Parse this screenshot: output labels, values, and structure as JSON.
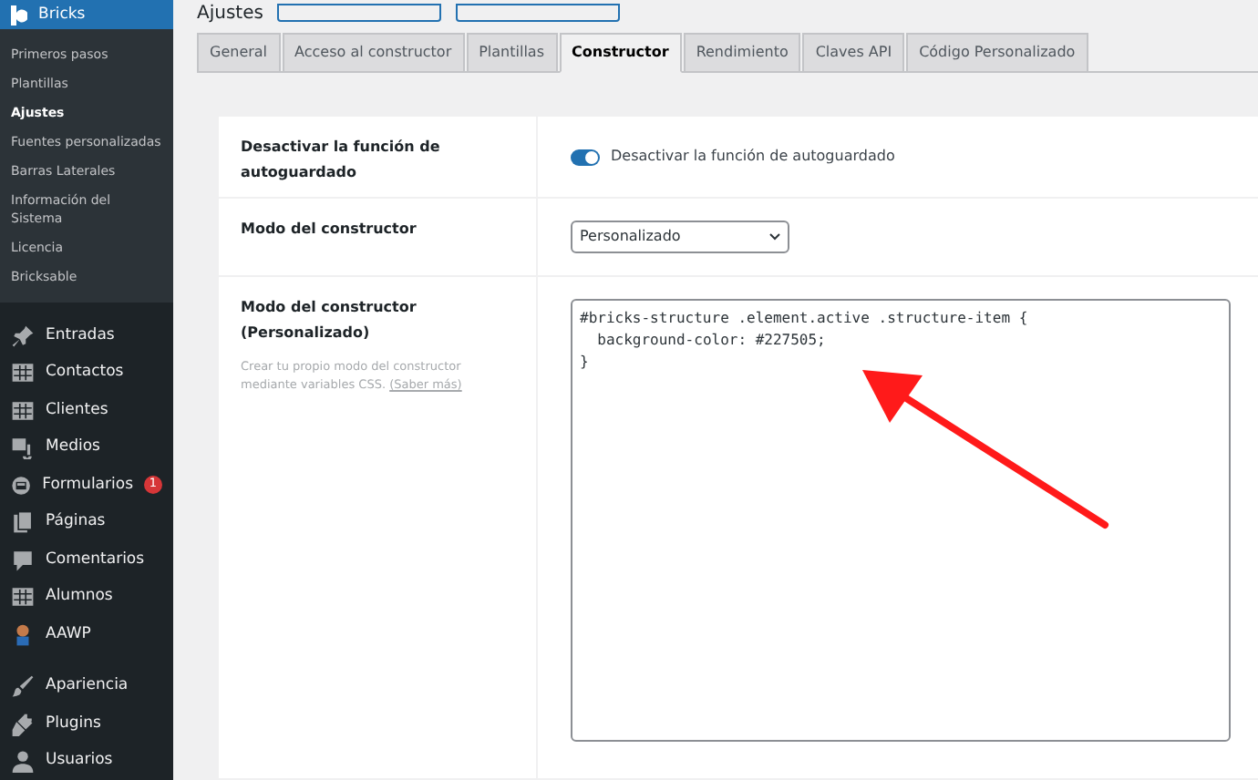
{
  "page_title": "Ajustes",
  "sidebar": {
    "brand": "Bricks",
    "submenu": [
      {
        "label": "Primeros pasos",
        "selected": false
      },
      {
        "label": "Plantillas",
        "selected": false
      },
      {
        "label": "Ajustes",
        "selected": true
      },
      {
        "label": "Fuentes personalizadas",
        "selected": false
      },
      {
        "label": "Barras Laterales",
        "selected": false
      },
      {
        "label": "Información del Sistema",
        "selected": false
      },
      {
        "label": "Licencia",
        "selected": false
      },
      {
        "label": "Bricksable",
        "selected": false
      }
    ],
    "menu": [
      {
        "label": "Entradas",
        "kind": "pin"
      },
      {
        "label": "Contactos",
        "kind": "grid"
      },
      {
        "label": "Clientes",
        "kind": "grid"
      },
      {
        "label": "Medios",
        "kind": "media"
      },
      {
        "label": "Formularios",
        "kind": "form",
        "badge": "1"
      },
      {
        "label": "Páginas",
        "kind": "pages"
      },
      {
        "label": "Comentarios",
        "kind": "comment"
      },
      {
        "label": "Alumnos",
        "kind": "grid"
      },
      {
        "label": "AAWP",
        "kind": "avatar"
      },
      {
        "label": "Apariencia",
        "kind": "brush"
      },
      {
        "label": "Plugins",
        "kind": "plug"
      },
      {
        "label": "Usuarios",
        "kind": "user"
      }
    ]
  },
  "tabs": [
    {
      "label": "General",
      "selected": false
    },
    {
      "label": "Acceso al constructor",
      "selected": false
    },
    {
      "label": "Plantillas",
      "selected": false
    },
    {
      "label": "Constructor",
      "selected": true
    },
    {
      "label": "Rendimiento",
      "selected": false
    },
    {
      "label": "Claves API",
      "selected": false
    },
    {
      "label": "Código Personalizado",
      "selected": false
    }
  ],
  "settings": [
    {
      "kind": "toggle",
      "label": "Desactivar la función de autoguardado",
      "toggle_label": "Desactivar la función de autoguardado",
      "on": true
    },
    {
      "kind": "select",
      "label": "Modo del constructor",
      "value": "Personalizado"
    },
    {
      "kind": "code",
      "label": "Modo del constructor (Personalizado)",
      "description": "Crear tu propio modo del constructor mediante variables CSS.",
      "link": "(Saber más)",
      "value": "#bricks-structure .element.active .structure-item {\n  background-color: #227505;\n}"
    }
  ]
}
